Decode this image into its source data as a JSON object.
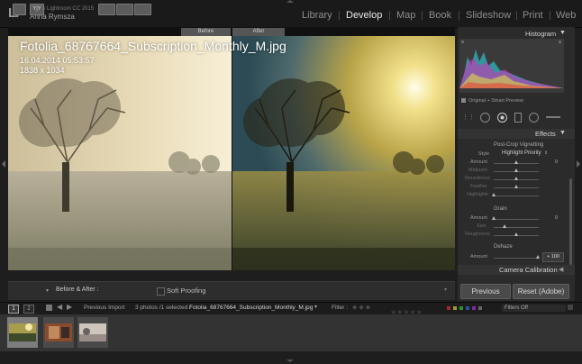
{
  "app": {
    "logo": "Lr",
    "name": "Adobe Lightroom CC 2015",
    "user": "Anna Rymsza"
  },
  "modules": [
    {
      "label": "Library",
      "active": false
    },
    {
      "label": "Develop",
      "active": true
    },
    {
      "label": "Map",
      "active": false
    },
    {
      "label": "Book",
      "active": false
    },
    {
      "label": "Slideshow",
      "active": false
    },
    {
      "label": "Print",
      "active": false
    },
    {
      "label": "Web",
      "active": false
    }
  ],
  "view": {
    "before_label": "Before",
    "after_label": "After"
  },
  "photo": {
    "filename": "Fotolia_68767664_Subscription_Monthly_M.jpg",
    "date": "16.04.2014 05:53:57",
    "dimensions": "1838 x 1034"
  },
  "toolbar": {
    "before_after_label": "Before & After :",
    "soft_proofing_label": "Soft Proofing",
    "view_mode": "Y|Y"
  },
  "histogram": {
    "title": "Histogram",
    "preview_label": "Original + Smart Preview"
  },
  "effects": {
    "title": "Effects",
    "post_crop": {
      "title": "Post-Crop Vignetting",
      "style_label": "Style",
      "style_value": "Highlight Priority",
      "sliders": [
        {
          "label": "Amount",
          "value": "0",
          "pos": 0.5
        },
        {
          "label": "Midpoint",
          "value": "",
          "pos": 0.5
        },
        {
          "label": "Roundness",
          "value": "",
          "pos": 0.5
        },
        {
          "label": "Feather",
          "value": "",
          "pos": 0.5
        },
        {
          "label": "Highlights",
          "value": "",
          "pos": 0.0
        }
      ]
    },
    "grain": {
      "title": "Grain",
      "sliders": [
        {
          "label": "Amount",
          "value": "0",
          "pos": 0.0
        },
        {
          "label": "Size",
          "value": "",
          "pos": 0.25
        },
        {
          "label": "Roughness",
          "value": "",
          "pos": 0.5
        }
      ]
    },
    "dehaze": {
      "title": "Dehaze",
      "amount_label": "Amount",
      "amount_value": "+ 100",
      "pos": 1.0
    }
  },
  "camera_calibration": {
    "title": "Camera Calibration"
  },
  "buttons": {
    "previous": "Previous",
    "reset": "Reset (Adobe)"
  },
  "filmbar": {
    "screen1": "1",
    "screen2": "2",
    "source": "Previous Import",
    "count": "3 photos /1 selected /",
    "selected_file": "Fotolia_68767664_Subscription_Monthly_M.jpg",
    "filter_label": "Filter :",
    "filters_value": "Filters Off"
  },
  "colors": {
    "accent": "#f0f0f0",
    "panel": "#2b2b2b",
    "background": "#1e1e1e"
  }
}
